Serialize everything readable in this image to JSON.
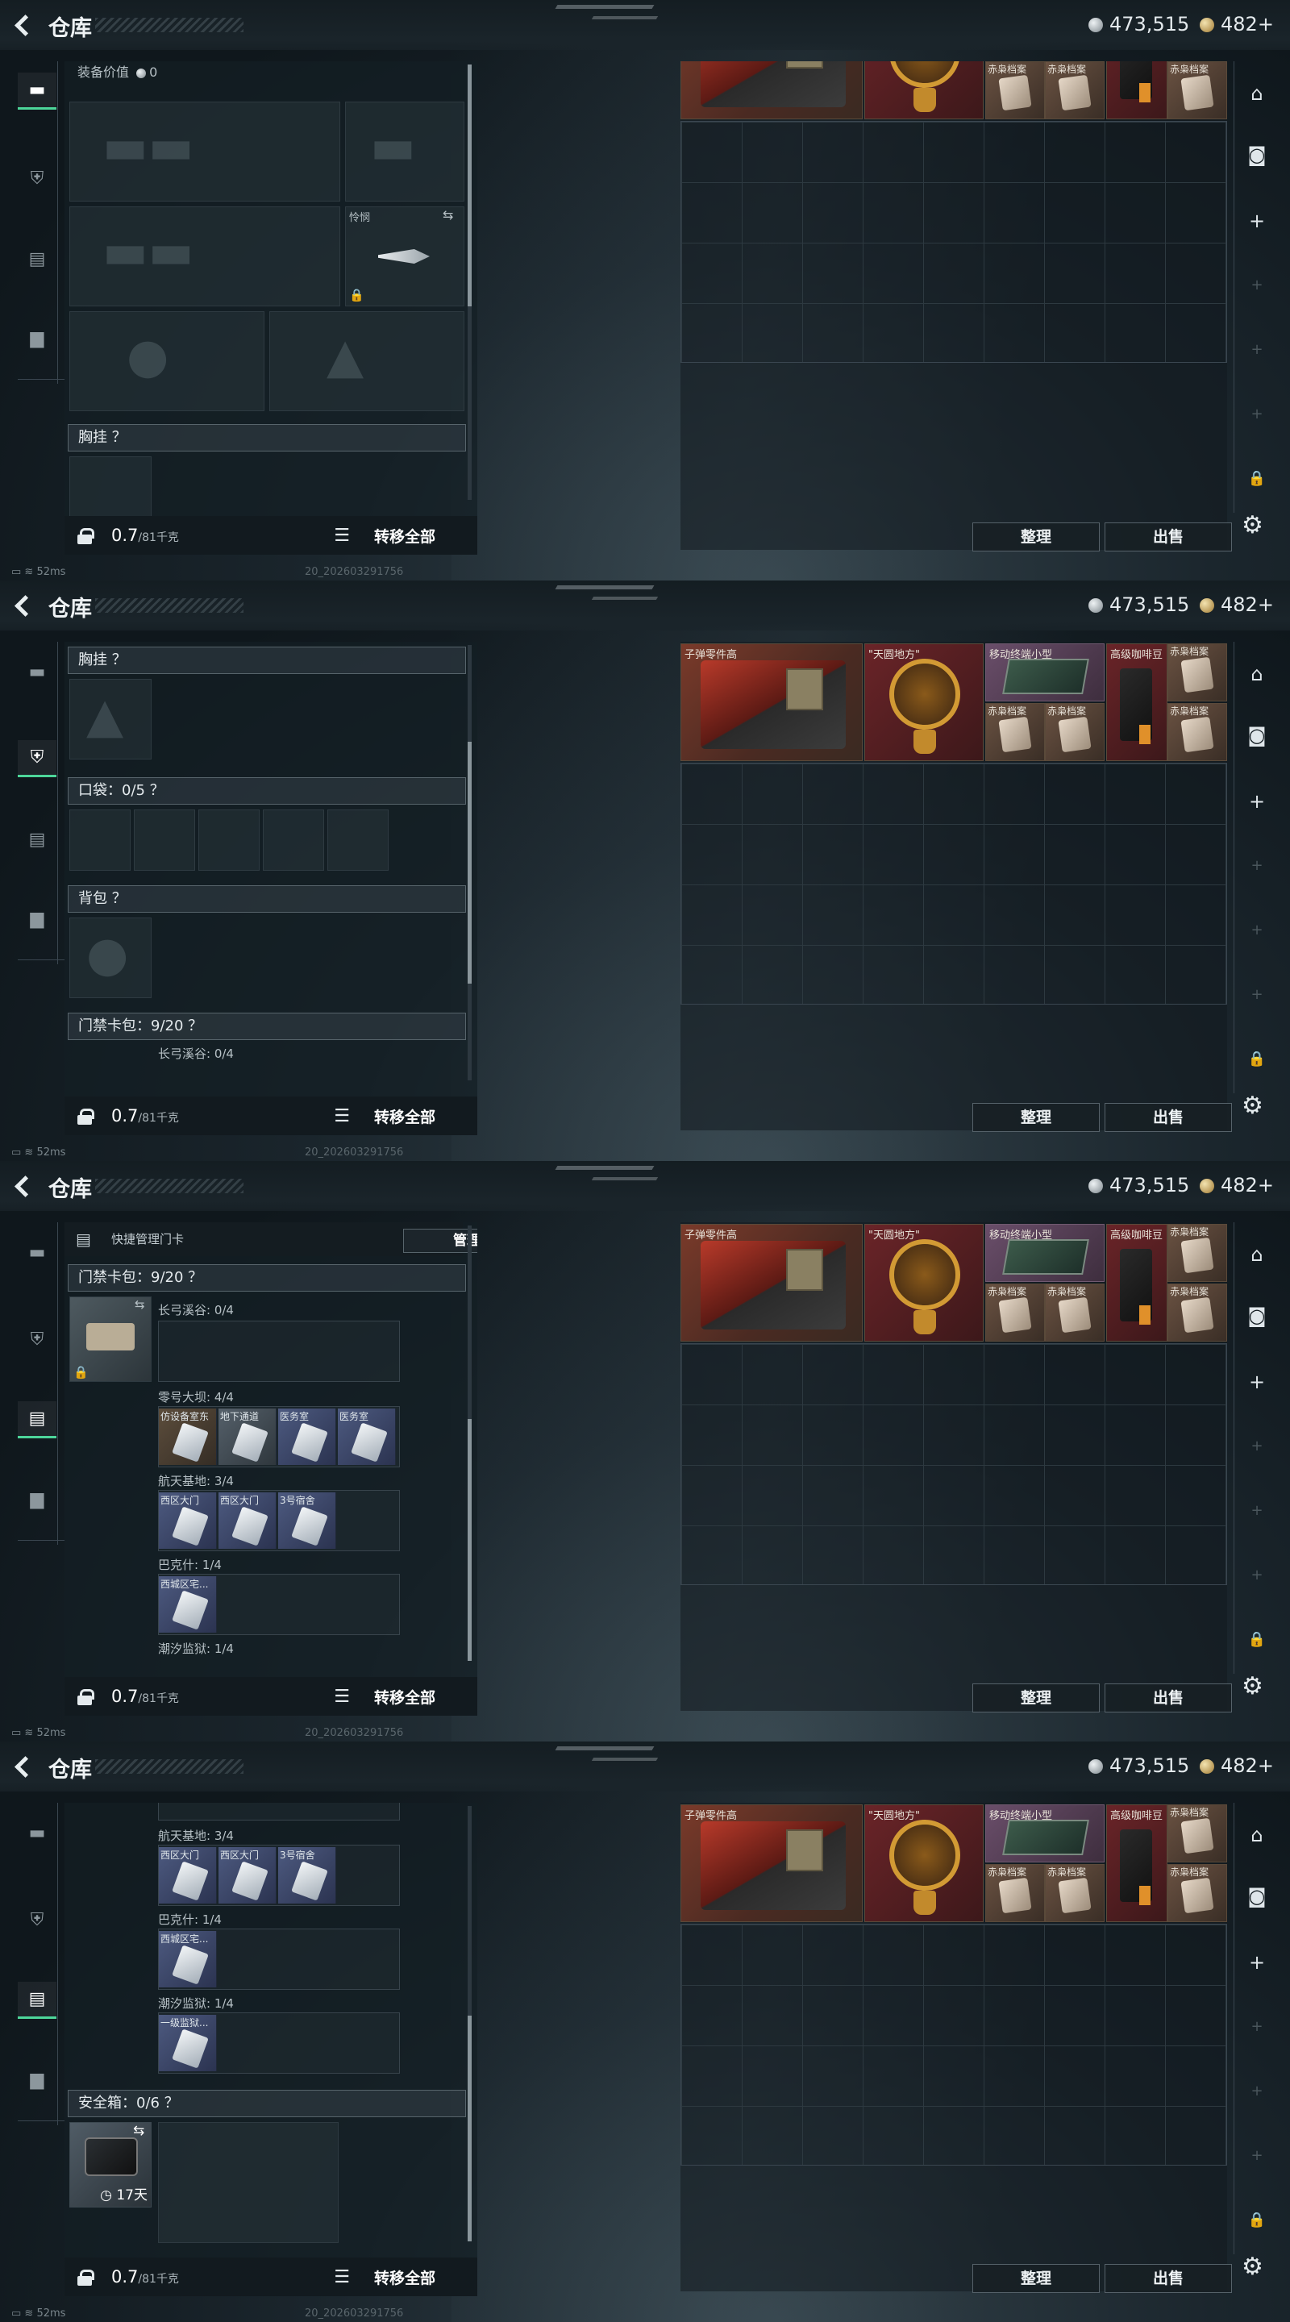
{
  "header": {
    "title": "仓库",
    "currency_silver": "473,515",
    "currency_gold": "482",
    "gold_plus": "+"
  },
  "status": {
    "ping": "52ms",
    "build": "20_202603291756"
  },
  "loadout": {
    "equip_value_label": "装备价值",
    "equip_value": "0",
    "melee_label": "怜悯",
    "chest_rig": "胸挂 ？",
    "pockets": "口袋：0/5 ？",
    "backpack": "背包 ？",
    "keycard_bag": "门禁卡包：9/20 ？",
    "safe_box": "安全箱：0/6 ？",
    "safe_timer": "17天",
    "quick_manage": "快捷管理门卡",
    "manage_btn": "管理",
    "weight": "0.7",
    "weight_max": "/81千克",
    "move_all": "转移全部"
  },
  "keycards": {
    "changgong": "长弓溪谷: 0/4",
    "dam": "零号大坝: 4/4",
    "dam_cards": [
      "仿设备室东",
      "地下通道",
      "医务室",
      "医务室"
    ],
    "space": "航天基地: 3/4",
    "space_cards": [
      "西区大门",
      "西区大门",
      "3号宿舍"
    ],
    "bakshi": "巴克什: 1/4",
    "bakshi_cards": [
      "西城区宅..."
    ],
    "prison": "潮汐监狱: 1/4",
    "prison_cards": [
      "一级监狱..."
    ]
  },
  "stash": {
    "items": {
      "ammo": "子弹零件高",
      "globe": "\"天圆地方\"",
      "router": "移动终端小型",
      "coffee": "高级咖啡豆",
      "fox": "赤枭档案"
    },
    "sort_btn": "整理",
    "sell_btn": "出售"
  }
}
